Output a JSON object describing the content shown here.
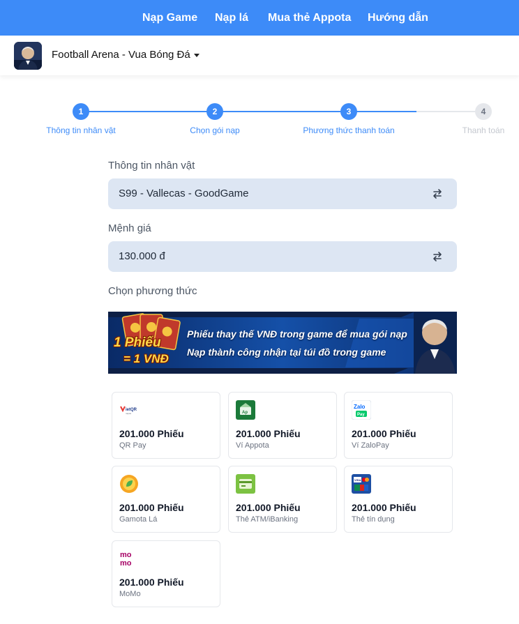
{
  "nav": {
    "items": [
      {
        "label": "Nạp Game"
      },
      {
        "label": "Nạp lá"
      },
      {
        "label": "Mua thẻ Appota"
      },
      {
        "label": "Hướng dẫn"
      }
    ]
  },
  "game": {
    "name": "Football Arena - Vua Bóng Đá"
  },
  "steps": [
    {
      "number": "1",
      "label": "Thông tin nhân vật",
      "state": "active"
    },
    {
      "number": "2",
      "label": "Chọn gói nạp",
      "state": "active"
    },
    {
      "number": "3",
      "label": "Phương thức thanh toán",
      "state": "active"
    },
    {
      "number": "4",
      "label": "Thanh toán",
      "state": "idle"
    }
  ],
  "form": {
    "character_label": "Thông tin nhân vật",
    "character_value": "S99 - Vallecas - GoodGame",
    "amount_label": "Mệnh giá",
    "amount_value": "130.000 đ",
    "method_label": "Chọn phương thức"
  },
  "banner": {
    "line1": "Phiếu thay thế VNĐ trong game để mua gói nạp",
    "line2": "Nạp thành công nhận tại túi đồ trong game",
    "badge_line1": "1 Phiếu",
    "badge_line2": "= 1 VNĐ"
  },
  "payments": [
    {
      "amount": "201.000 Phiếu",
      "name": "QR Pay",
      "icon": "vietqr-icon"
    },
    {
      "amount": "201.000 Phiếu",
      "name": "Ví Appota",
      "icon": "appota-wallet-icon"
    },
    {
      "amount": "201.000 Phiếu",
      "name": "Ví ZaloPay",
      "icon": "zalopay-icon"
    },
    {
      "amount": "201.000 Phiếu",
      "name": "Gamota Lá",
      "icon": "gamota-leaf-icon"
    },
    {
      "amount": "201.000 Phiếu",
      "name": "Thẻ ATM/iBanking",
      "icon": "atm-card-icon"
    },
    {
      "amount": "201.000 Phiếu",
      "name": "Thẻ tín dụng",
      "icon": "credit-card-icon"
    },
    {
      "amount": "201.000 Phiếu",
      "name": "MoMo",
      "icon": "momo-icon"
    }
  ],
  "colors": {
    "primary": "#3d8bf8",
    "select_bg": "#dde6f3",
    "momo": "#a50064"
  }
}
